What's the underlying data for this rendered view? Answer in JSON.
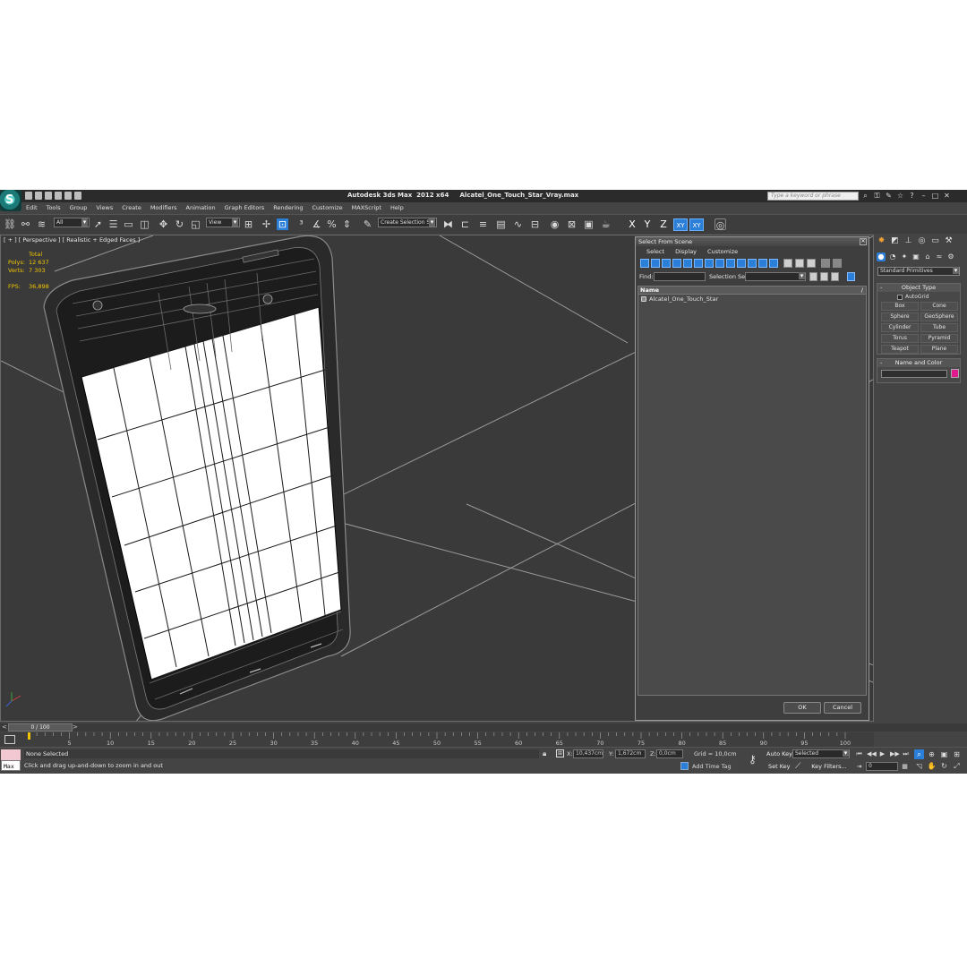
{
  "titlebar": {
    "title": "Autodesk 3ds Max  2012 x64     Alcatel_One_Touch_Star_Vray.max",
    "search_placeholder": "Type a keyword or phrase"
  },
  "menu": [
    "Edit",
    "Tools",
    "Group",
    "Views",
    "Create",
    "Modifiers",
    "Animation",
    "Graph Editors",
    "Rendering",
    "Customize",
    "MAXScript",
    "Help"
  ],
  "toolbar": {
    "selection_filter": "All",
    "ref_coord": "View",
    "selection_set": "Create Selection Se",
    "axes": [
      "X",
      "Y",
      "Z",
      "XY",
      "XY"
    ]
  },
  "viewport": {
    "label": "[ + ] [ Perspective ] [ Realistic + Edged Faces ]",
    "stats": {
      "total_label": "Total",
      "polys_label": "Polys:",
      "polys": "12 637",
      "verts_label": "Verts:",
      "verts": "7 303",
      "fps_label": "FPS:",
      "fps": "36,898"
    }
  },
  "select_dialog": {
    "title": "Select From Scene",
    "menu": [
      "Select",
      "Display",
      "Customize"
    ],
    "find_label": "Find:",
    "selection_set_label": "Selection Set:",
    "column_name": "Name",
    "sort_indicator": "/",
    "items": [
      "Alcatel_One_Touch_Star"
    ],
    "ok_label": "OK",
    "cancel_label": "Cancel"
  },
  "command_panel": {
    "category": "Standard Primitives",
    "object_type_title": "Object Type",
    "autogrid_label": "AutoGrid",
    "primitives": [
      "Box",
      "Cone",
      "Sphere",
      "GeoSphere",
      "Cylinder",
      "Tube",
      "Torus",
      "Pyramid",
      "Teapot",
      "Plane"
    ],
    "name_color_title": "Name and Color",
    "object_color": "#e0198c"
  },
  "timeline": {
    "frame_display": "0 / 100",
    "ticks": [
      "5",
      "10",
      "15",
      "20",
      "25",
      "30",
      "35",
      "40",
      "45",
      "50",
      "55",
      "60",
      "65",
      "70",
      "75",
      "80",
      "85",
      "90",
      "95",
      "100"
    ]
  },
  "status": {
    "listener_text": "Max",
    "selection": "None Selected",
    "prompt": "Click and drag up-and-down to zoom in and out",
    "x_label": "X:",
    "x_value": "10,437cm",
    "y_label": "Y:",
    "y_value": "1,672cm",
    "z_label": "Z:",
    "z_value": "0,0cm",
    "grid": "Grid = 10,0cm",
    "add_time_tag": "Add Time Tag",
    "auto_key": "Auto Key",
    "set_key": "Set Key",
    "key_mode": "Selected",
    "key_filters": "Key Filters...",
    "current_frame": "0"
  },
  "colors": {
    "accent": "#2c7fd8",
    "stats": "#f2c500",
    "viewport_bg": "#3a3a3a"
  }
}
